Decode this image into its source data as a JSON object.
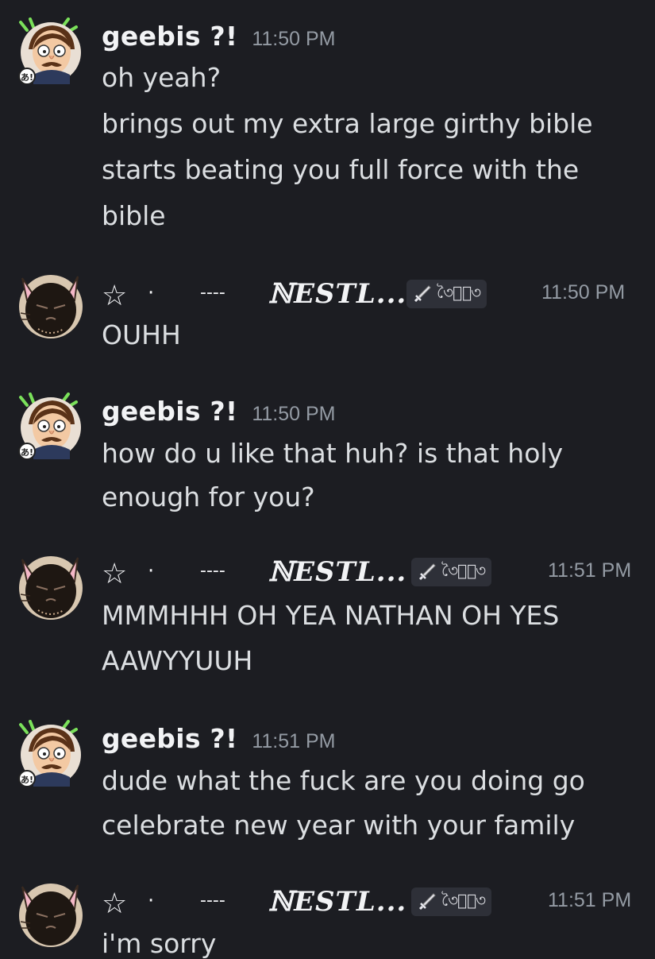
{
  "users": {
    "geebis": {
      "name": "geebis ?!",
      "avatar_icon": "cartoon-man-avatar",
      "badge": "あ!"
    },
    "nestl": {
      "star": "☆",
      "dot": "·",
      "dash": "----",
      "name": "ℕESTL...",
      "tag_icon": "sword-icon",
      "tag_ornament": "৩ৈ⟡ৈ৩",
      "avatar_icon": "cat-avatar"
    }
  },
  "messages": [
    {
      "author": "geebis",
      "time": "11:50 PM",
      "lines": [
        "oh yeah?",
        "brings out my extra large girthy bible",
        "starts beating you full force with the",
        "bible"
      ]
    },
    {
      "author": "nestl",
      "time": "11:50 PM",
      "lines": [
        "OUHH"
      ]
    },
    {
      "author": "geebis",
      "time": "11:50 PM",
      "lines": [
        "how do u like that huh? is that holy",
        "enough for you?"
      ]
    },
    {
      "author": "nestl",
      "time": "11:51 PM",
      "lines": [
        "MMMHHH OH YEA NATHAN OH YES",
        "AAWYYUUH"
      ]
    },
    {
      "author": "geebis",
      "time": "11:51 PM",
      "lines": [
        "dude what the fuck are you doing go",
        "celebrate new year with your family"
      ]
    },
    {
      "author": "nestl",
      "time": "11:51 PM",
      "lines": [
        "i'm sorry"
      ]
    }
  ],
  "colors": {
    "background": "#1c1d22",
    "username": "#f2f3f5",
    "timestamp": "#949ba4",
    "message_text": "#dbdee1",
    "tag_background": "#2e3038"
  }
}
